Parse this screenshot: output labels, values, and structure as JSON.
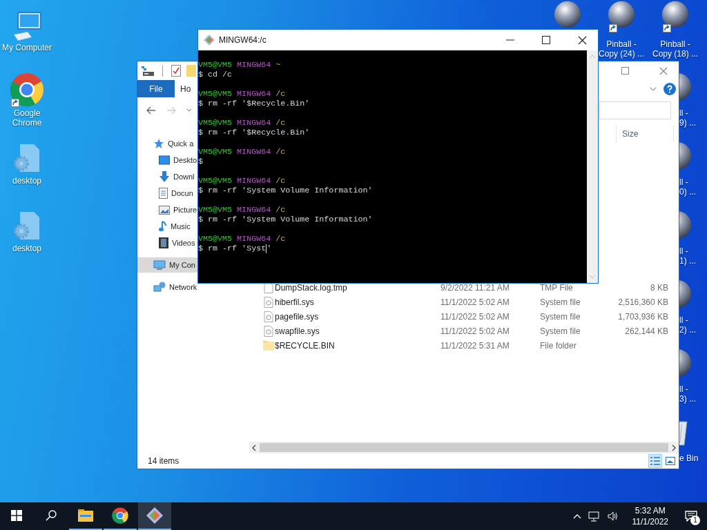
{
  "desktop_left": [
    {
      "kind": "computer",
      "shortcut": false,
      "label_lines": [
        "My Computer"
      ]
    },
    {
      "kind": "chrome",
      "shortcut": true,
      "label_lines": [
        "Google",
        "Chrome"
      ]
    },
    {
      "kind": "config",
      "shortcut": false,
      "label_lines": [
        "desktop"
      ]
    },
    {
      "kind": "config",
      "shortcut": false,
      "label_lines": [
        "desktop"
      ]
    }
  ],
  "desktop_top_row": [
    {
      "kind": "pinball",
      "shortcut": false
    },
    {
      "kind": "pinball",
      "shortcut": true,
      "label_lines": [
        "Pinball -",
        "Copy (24) ..."
      ]
    },
    {
      "kind": "pinball",
      "shortcut": true,
      "label_lines": [
        "Pinball -",
        "Copy (18) ..."
      ]
    }
  ],
  "desktop_right_column": [
    {
      "kind": "pinball",
      "label_lines": [
        "ll -",
        "9) ..."
      ]
    },
    {
      "kind": "pinball",
      "label_lines": [
        "ll -",
        "0) ..."
      ]
    },
    {
      "kind": "pinball",
      "label_lines": [
        "ll -",
        "1) ..."
      ]
    },
    {
      "kind": "pinball",
      "label_lines": [
        "ll -",
        "2) ..."
      ]
    },
    {
      "kind": "pinball",
      "label_lines": [
        "ll -",
        "3) ..."
      ]
    },
    {
      "kind": "recycle_bin",
      "label_lines": [
        "e Bin"
      ]
    }
  ],
  "explorer": {
    "tabs": [
      {
        "label": "File",
        "selected": true
      },
      {
        "label": "Ho",
        "selected": false
      }
    ],
    "nav": [
      {
        "label": "Quick a",
        "kind": "star",
        "selected": false,
        "children": [
          {
            "label": "Deskto",
            "kind": "desktop",
            "selected": false
          },
          {
            "label": "Downl",
            "kind": "download",
            "selected": false
          },
          {
            "label": "Docun",
            "kind": "document",
            "selected": false
          },
          {
            "label": "Picture",
            "kind": "picture",
            "selected": false
          },
          {
            "label": "Music",
            "kind": "music",
            "selected": false
          },
          {
            "label": "Videos",
            "kind": "video",
            "selected": false
          }
        ]
      },
      {
        "label": "My Con",
        "kind": "computer",
        "selected": true
      },
      {
        "label": "Network",
        "kind": "network",
        "selected": false
      }
    ],
    "columns": [
      {
        "label": "Size"
      }
    ],
    "rows": [
      {
        "kind": "blank",
        "name": "DumpStack.log.tmp",
        "date": "9/2/2022 11:21 AM",
        "type": "TMP File",
        "size": "8 KB"
      },
      {
        "kind": "system",
        "name": "hiberfil.sys",
        "date": "11/1/2022 5:02 AM",
        "type": "System file",
        "size": "2,516,360 KB"
      },
      {
        "kind": "system",
        "name": "pagefile.sys",
        "date": "11/1/2022 5:02 AM",
        "type": "System file",
        "size": "1,703,936 KB"
      },
      {
        "kind": "system",
        "name": "swapfile.sys",
        "date": "11/1/2022 5:02 AM",
        "type": "System file",
        "size": "262,144 KB"
      },
      {
        "kind": "folder",
        "name": "$RECYCLE.BIN",
        "date": "11/1/2022 5:31 AM",
        "type": "File folder"
      }
    ],
    "status": "14 items",
    "views": [
      {
        "kind": "details",
        "selected": true
      },
      {
        "kind": "tiles",
        "selected": false
      }
    ]
  },
  "terminal": {
    "title": "MINGW64:/c",
    "lines": [
      {
        "kind": "prompt",
        "user": "VM5@VM5",
        "shell": "MINGW64",
        "path": "~"
      },
      {
        "kind": "command",
        "text": "$ cd /c",
        "cursor": false
      },
      {
        "kind": "prompt",
        "user": "VM5@VM5",
        "shell": "MINGW64",
        "path": "/c"
      },
      {
        "kind": "command",
        "text": "$ rm -rf '$Recycle.Bin'",
        "cursor": false
      },
      {
        "kind": "prompt",
        "user": "VM5@VM5",
        "shell": "MINGW64",
        "path": "/c"
      },
      {
        "kind": "command",
        "text": "$ rm -rf '$Recycle.Bin'",
        "cursor": false
      },
      {
        "kind": "prompt",
        "user": "VM5@VM5",
        "shell": "MINGW64",
        "path": "/c"
      },
      {
        "kind": "command",
        "text": "$",
        "cursor": false
      },
      {
        "kind": "prompt",
        "user": "VM5@VM5",
        "shell": "MINGW64",
        "path": "/c"
      },
      {
        "kind": "command",
        "text": "$ rm -rf 'System Volume Information'",
        "cursor": false
      },
      {
        "kind": "prompt",
        "user": "VM5@VM5",
        "shell": "MINGW64",
        "path": "/c"
      },
      {
        "kind": "command",
        "text": "$ rm -rf 'System Volume Information'",
        "cursor": false
      },
      {
        "kind": "prompt",
        "user": "VM5@VM5",
        "shell": "MINGW64",
        "path": "/c"
      },
      {
        "kind": "command",
        "text": "$ rm -rf 'Syst",
        "cursor": true,
        "after": "'"
      }
    ]
  },
  "taskbar": {
    "apps": [
      {
        "kind": "start",
        "running": false,
        "active": false
      },
      {
        "kind": "search",
        "running": false,
        "active": false
      },
      {
        "kind": "explorer",
        "running": true,
        "active": false
      },
      {
        "kind": "chrome",
        "running": true,
        "active": false
      },
      {
        "kind": "git",
        "running": true,
        "active": true
      }
    ],
    "time": "5:32 AM",
    "date": "11/1/2022",
    "notifications": "1"
  }
}
